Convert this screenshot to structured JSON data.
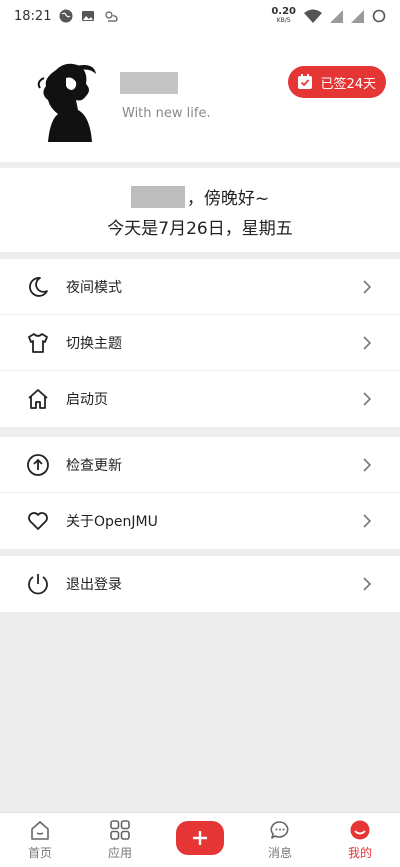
{
  "status_bar": {
    "time": "18:21",
    "speed_value": "0.20",
    "speed_unit": "KB/S"
  },
  "profile": {
    "slogan": "With new life.",
    "sign_badge": "已签24天"
  },
  "greeting": {
    "suffix": "，傍晚好~",
    "date": "今天是7月26日，星期五"
  },
  "menu": {
    "group1": [
      {
        "label": "夜间模式",
        "icon": "moon-icon"
      },
      {
        "label": "切换主题",
        "icon": "shirt-icon"
      },
      {
        "label": "启动页",
        "icon": "home-icon"
      }
    ],
    "group2": [
      {
        "label": "检查更新",
        "icon": "upload-circle-icon"
      },
      {
        "label": "关于OpenJMU",
        "icon": "heart-icon"
      }
    ],
    "group3": [
      {
        "label": "退出登录",
        "icon": "power-icon"
      }
    ]
  },
  "bottom_nav": {
    "home": "首页",
    "apps": "应用",
    "messages": "消息",
    "mine": "我的"
  },
  "colors": {
    "accent": "#e53535",
    "background": "#ededed"
  }
}
